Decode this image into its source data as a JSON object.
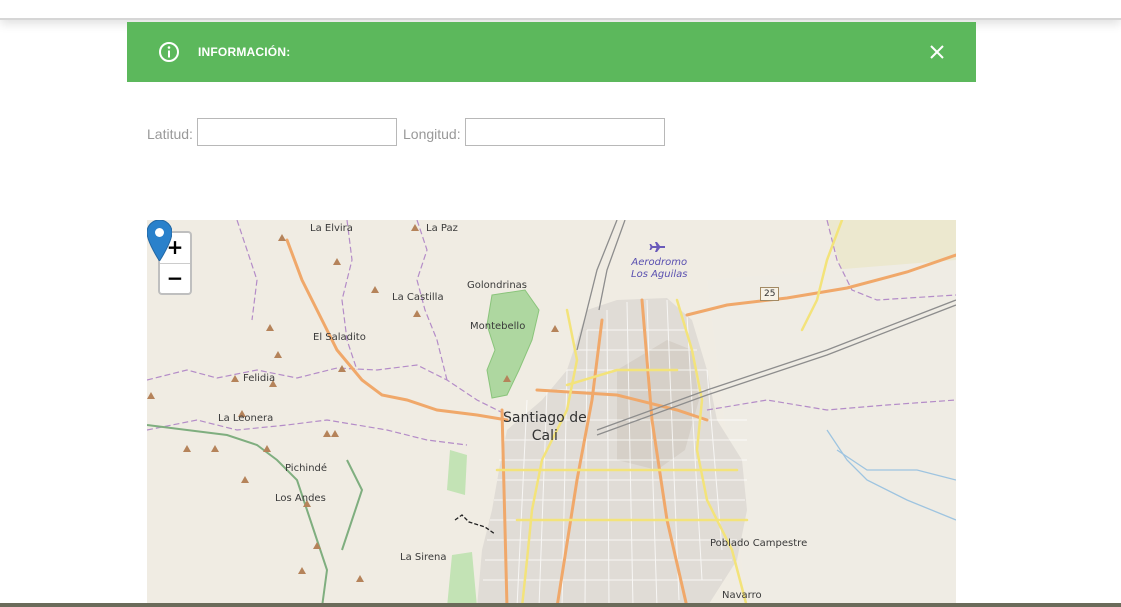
{
  "alert": {
    "title": "INFORMACIÓN:",
    "color": "#5cb85c"
  },
  "form": {
    "latitude_label": "Latitud:",
    "latitude_value": "",
    "longitude_label": "Longitud:",
    "longitude_value": ""
  },
  "map": {
    "zoom_in_label": "+",
    "zoom_out_label": "−",
    "labels": {
      "la_elvira": "La Elvira",
      "la_paz": "La Paz",
      "aerodromo": "Aerodromo",
      "los_aguilas": "Los Aguilas",
      "route_25": "25",
      "golondrinas": "Golondrinas",
      "la_castilla": "La Castilla",
      "montebello": "Montebello",
      "el_saladito": "El Saladito",
      "felidia": "Felidia",
      "santiago_1": "Santiago de",
      "santiago_2": "Cali",
      "la_leonera": "La Leonera",
      "pichinde": "Pichindé",
      "los_andes": "Los Andes",
      "la_sirena": "La Sirena",
      "poblado_campestre": "Poblado Campestre",
      "navarro": "Navarro"
    }
  }
}
